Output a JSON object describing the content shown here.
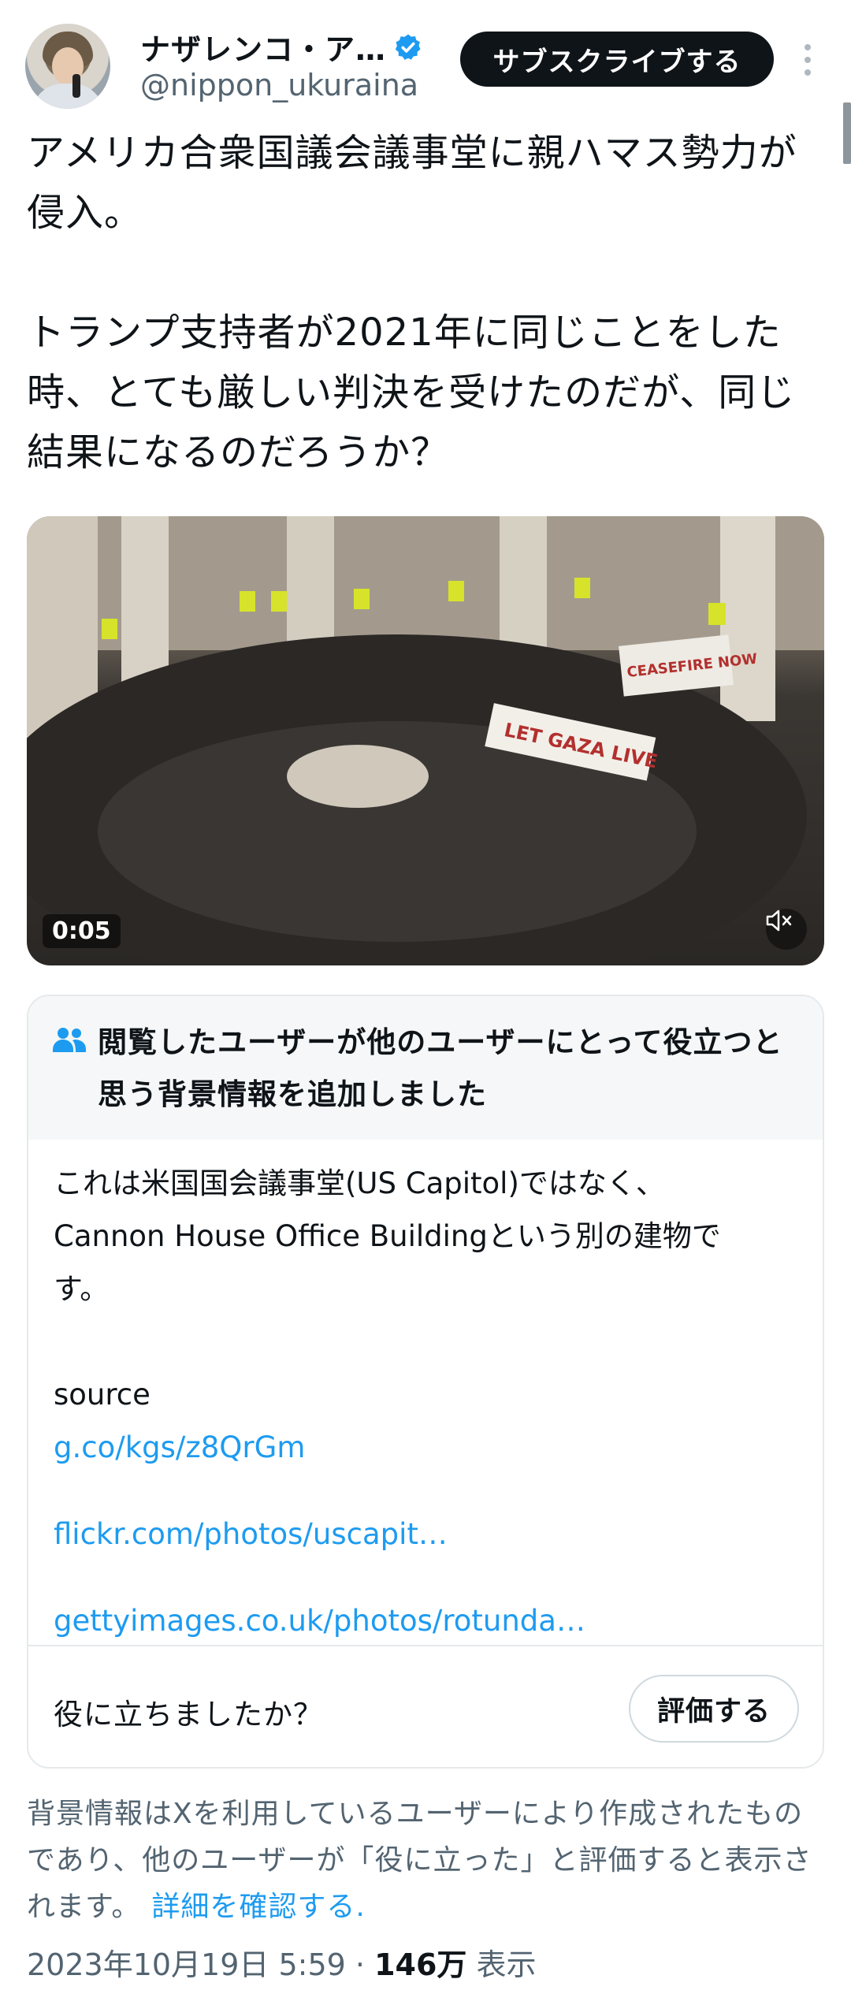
{
  "author": {
    "display_name": "ナザレンコ・ア…",
    "handle": "@nippon_ukuraina"
  },
  "header": {
    "subscribe_label": "サブスクライブする"
  },
  "tweet": {
    "paragraphs": [
      "アメリカ合衆国議会議事堂に親ハマス勢力が\n侵入。",
      "トランプ支持者が2021年に同じことをした\n時、とても厳しい判決を受けたのだが、同じ\n結果になるのだろうか？"
    ]
  },
  "media": {
    "duration": "0:05",
    "banner_text_1": "LET GAZA LIVE",
    "banner_text_2": "CEASEFIRE NOW"
  },
  "community_note": {
    "title": "閲覧したユーザーが他のユーザーにとって役立つと\n思う背景情報を追加しました",
    "body": "これは米国国会議事堂(US Capitol)ではなく、\nCannon House Office Buildingという別の建物で\nす。",
    "source_label": "source",
    "links": [
      "g.co/kgs/z8QrGm",
      "flickr.com/photos/uscapit…",
      "gettyimages.co.uk/photos/rotunda…"
    ],
    "helpful_question": "役に立ちましたか？",
    "rate_label": "評価する"
  },
  "disclaimer": {
    "text": "背景情報はXを利用しているユーザーにより作成されたものであり、他のユーザーが「役に立った」と評価すると表示されます。",
    "link_label": "詳細を確認する."
  },
  "meta": {
    "datetime": "2023年10月19日 5:59",
    "separator": " · ",
    "views": "146万",
    "views_label": " 表示"
  },
  "colors": {
    "accent": "#1d9bf0",
    "text": "#0f1419",
    "secondary": "#536471"
  }
}
